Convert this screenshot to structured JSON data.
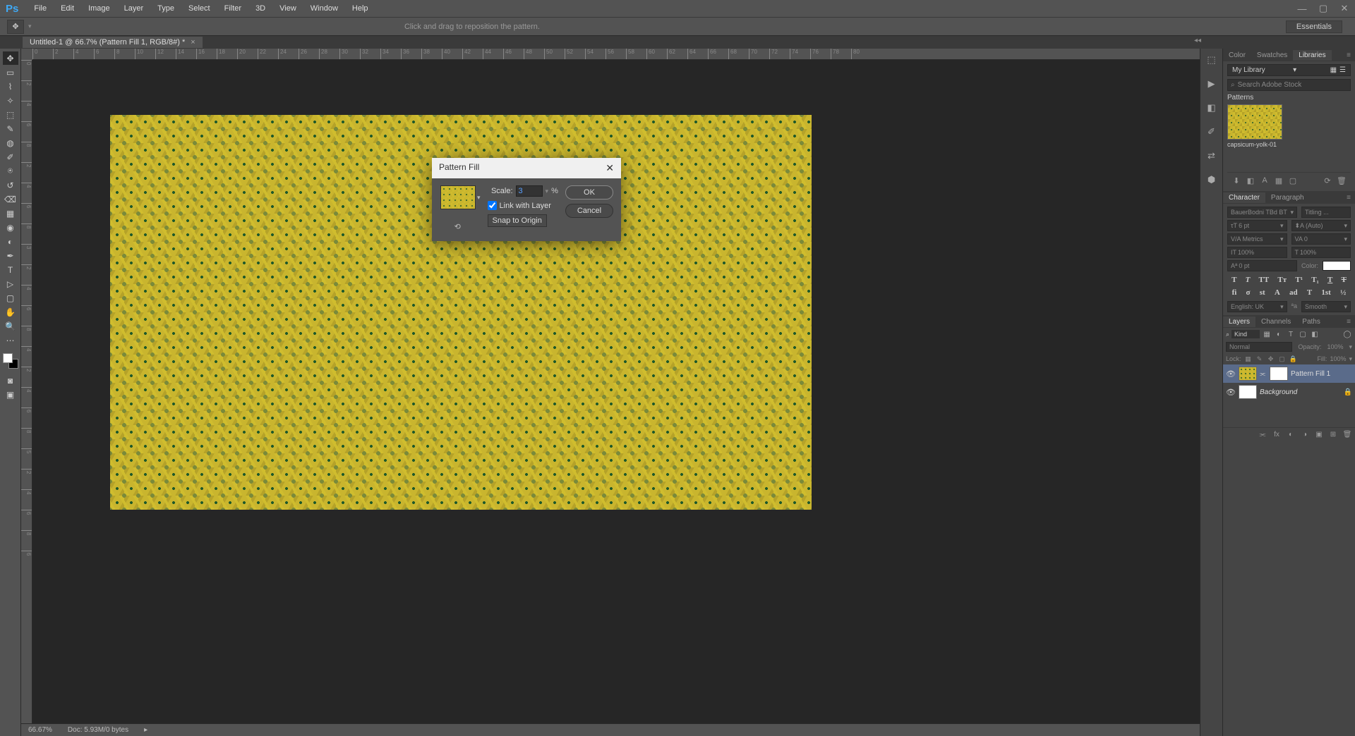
{
  "app": {
    "logo": "Ps"
  },
  "menu": {
    "file": "File",
    "edit": "Edit",
    "image": "Image",
    "layer": "Layer",
    "type": "Type",
    "select": "Select",
    "filter": "Filter",
    "threeD": "3D",
    "view": "View",
    "window": "Window",
    "help": "Help"
  },
  "options": {
    "hint": "Click and drag to reposition the pattern.",
    "workspace": "Essentials"
  },
  "doc": {
    "tab": "Untitled-1 @ 66.7% (Pattern Fill 1, RGB/8#) *"
  },
  "ruler_h": [
    "0",
    "2",
    "4",
    "6",
    "8",
    "10",
    "12",
    "14",
    "16",
    "18",
    "20",
    "22",
    "24",
    "26",
    "28",
    "30",
    "32",
    "34",
    "36",
    "38",
    "40",
    "42",
    "44",
    "46",
    "48",
    "50",
    "52",
    "54",
    "56",
    "58",
    "60",
    "62",
    "64",
    "66",
    "68",
    "70",
    "72",
    "74",
    "76",
    "78",
    "80"
  ],
  "ruler_v": [
    "0",
    "2",
    "4",
    "6",
    "8",
    "2",
    "4",
    "6",
    "8",
    "3",
    "2",
    "4",
    "6",
    "8",
    "4",
    "2",
    "4",
    "6",
    "8",
    "5",
    "2",
    "4",
    "6",
    "8",
    "6"
  ],
  "status": {
    "zoom": "66.67%",
    "doc_info": "Doc: 5.93M/0 bytes"
  },
  "dialog": {
    "title": "Pattern Fill",
    "scale_label": "Scale:",
    "scale_value": "3",
    "scale_unit": "%",
    "link_label": "Link with Layer",
    "link_checked": true,
    "snap_label": "Snap to Origin",
    "ok": "OK",
    "cancel": "Cancel"
  },
  "libraries": {
    "tab_color": "Color",
    "tab_swatches": "Swatches",
    "tab_libraries": "Libraries",
    "dropdown": "My Library",
    "search_placeholder": "Search Adobe Stock",
    "category": "Patterns",
    "asset_name": "capsicum-yolk-01"
  },
  "character": {
    "tab_character": "Character",
    "tab_paragraph": "Paragraph",
    "font": "BauerBodni TBd BT",
    "style": "Titling ...",
    "size": "6 pt",
    "leading": "(Auto)",
    "kerning": "Metrics",
    "tracking": "0",
    "vscale": "100%",
    "hscale": "100%",
    "baseline": "0 pt",
    "color_label": "Color:",
    "lang": "English: UK",
    "aa": "Smooth"
  },
  "layers": {
    "tab_layers": "Layers",
    "tab_channels": "Channels",
    "tab_paths": "Paths",
    "filter_kind": "Kind",
    "blend": "Normal",
    "opacity_label": "Opacity:",
    "opacity": "100%",
    "lock_label": "Lock:",
    "fill_label": "Fill:",
    "fill": "100%",
    "layer1": "Pattern Fill 1",
    "layer2": "Background"
  }
}
